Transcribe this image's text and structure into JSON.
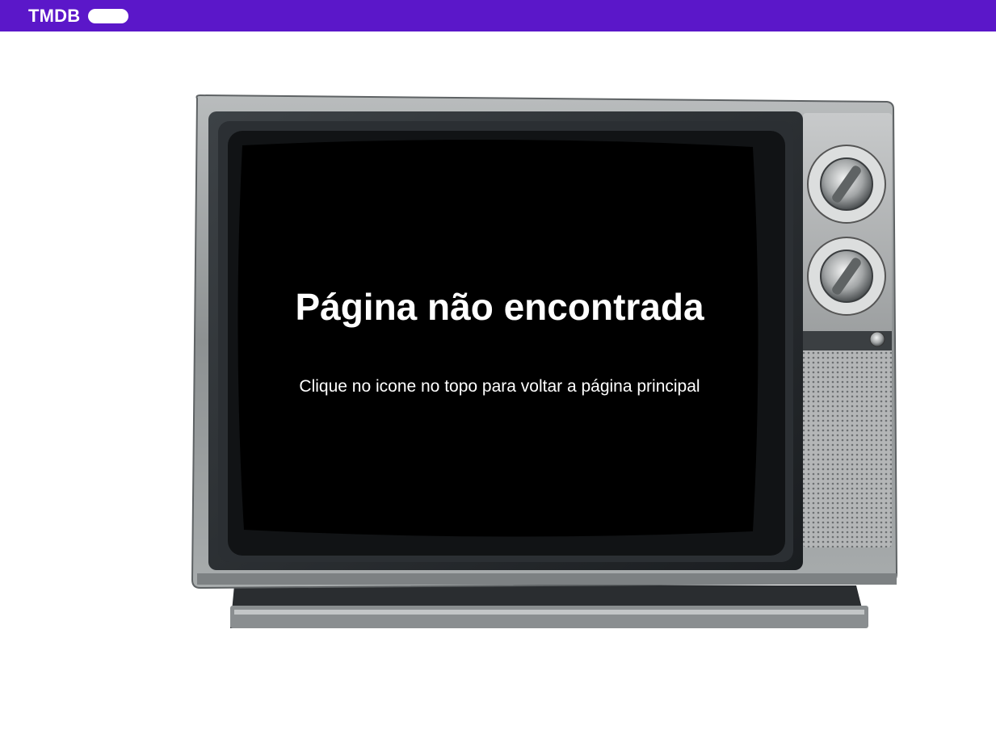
{
  "header": {
    "logo_text": "TMDB",
    "background_color": "#5b17c9"
  },
  "main": {
    "title": "Página não encontrada",
    "message": "Clique no icone no topo para voltar a página principal",
    "illustration": "vintage-tv"
  }
}
